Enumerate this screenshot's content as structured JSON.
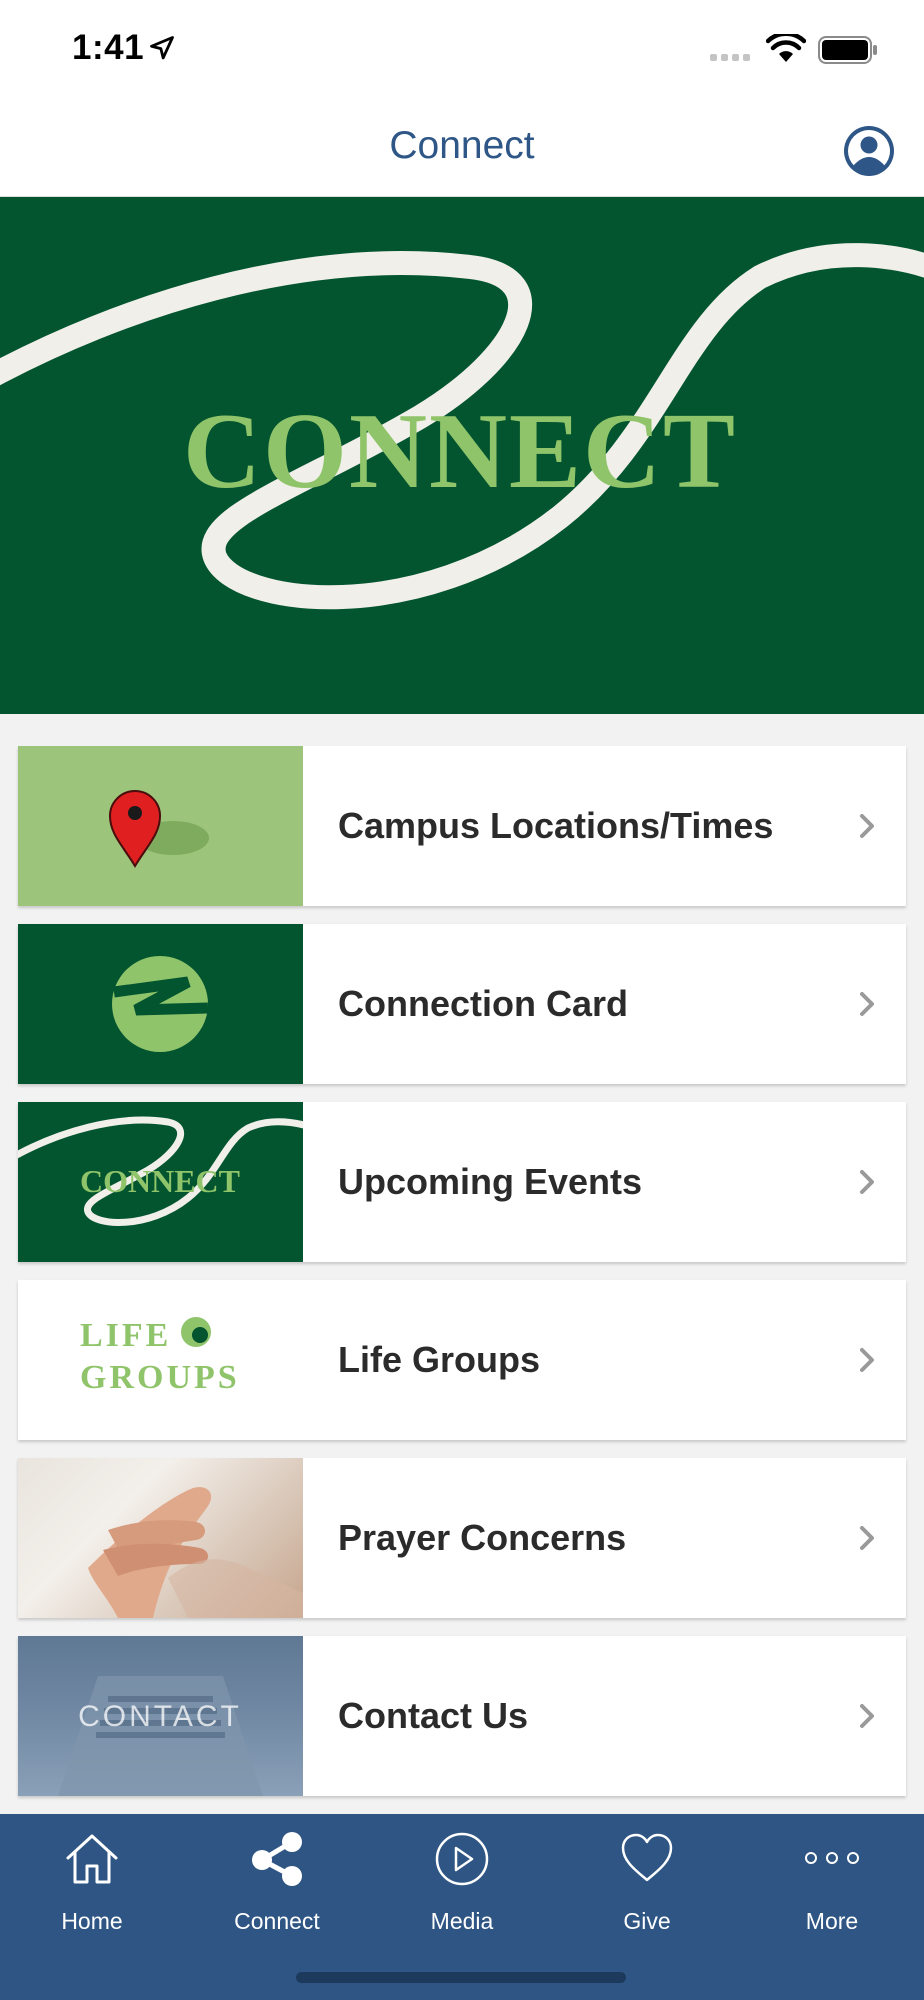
{
  "status_bar": {
    "time": "1:41"
  },
  "nav": {
    "title": "Connect"
  },
  "hero": {
    "text": "CONNECT"
  },
  "items": [
    {
      "label": "Campus Locations/Times",
      "icon": "map-pin-icon"
    },
    {
      "label": "Connection Card",
      "icon": "church-logo-icon"
    },
    {
      "label": "Upcoming Events",
      "icon": "connect-banner"
    },
    {
      "label": "Life Groups",
      "icon": "life-groups-logo",
      "logo_line1": "LIFE",
      "logo_line2": "GROUPS"
    },
    {
      "label": "Prayer Concerns",
      "icon": "praying-hands-image"
    },
    {
      "label": "Contact Us",
      "icon": "contact-image",
      "overlay": "CONTACT"
    }
  ],
  "tabs": [
    {
      "label": "Home",
      "icon": "home-icon"
    },
    {
      "label": "Connect",
      "icon": "share-icon"
    },
    {
      "label": "Media",
      "icon": "play-icon"
    },
    {
      "label": "Give",
      "icon": "heart-icon"
    },
    {
      "label": "More",
      "icon": "more-dots-icon"
    }
  ],
  "colors": {
    "brand_green": "#03552f",
    "light_green": "#8fc46a",
    "tab_blue": "#2e5583",
    "nav_title": "#2e5686"
  }
}
